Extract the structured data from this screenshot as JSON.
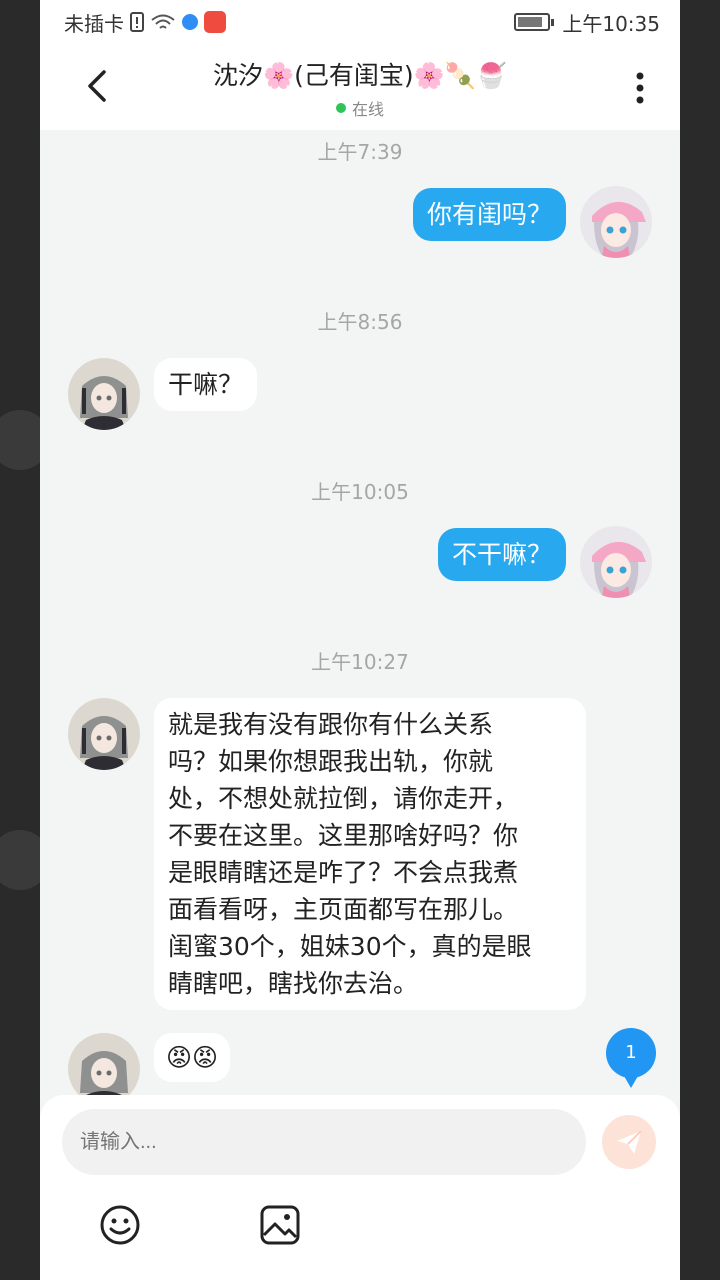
{
  "status_bar": {
    "carrier": "未插卡",
    "time": "上午10:35"
  },
  "header": {
    "title": "沈汐🌸(己有闺宝)🌸🍡🍧",
    "status": "在线"
  },
  "messages": [
    {
      "timestamp": "上午7:39",
      "direction": "out",
      "text": "你有闺吗？"
    },
    {
      "timestamp": "上午8:56",
      "direction": "in",
      "text": "干嘛？"
    },
    {
      "timestamp": "上午10:05",
      "direction": "out",
      "text": "不干嘛？"
    },
    {
      "timestamp": "上午10:27",
      "direction": "in",
      "lines": [
        "就是我有没有跟你有什么关系",
        "吗？如果你想跟我出轨，你就",
        "处，不想处就拉倒，请你走开，",
        "不要在这里。这里那啥好吗？你",
        "是眼睛瞎还是咋了？不会点我煮",
        "面看看呀，主页面都写在那儿。",
        "闺蜜30个，姐妹30个，真的是眼",
        "睛瞎吧，瞎找你去治。"
      ]
    },
    {
      "direction": "in",
      "emoji": "😡😡"
    }
  ],
  "unread_count": "1",
  "composer": {
    "placeholder": "请输入..."
  },
  "colors": {
    "out_bubble": "#28a8ef",
    "in_bubble": "#ffffff",
    "chat_bg": "#f3f5f4",
    "online": "#2fc457",
    "unread_badge": "#2196f3"
  },
  "icons": [
    "back-arrow-icon",
    "more-vertical-icon",
    "emoji-icon",
    "image-icon",
    "send-icon"
  ]
}
